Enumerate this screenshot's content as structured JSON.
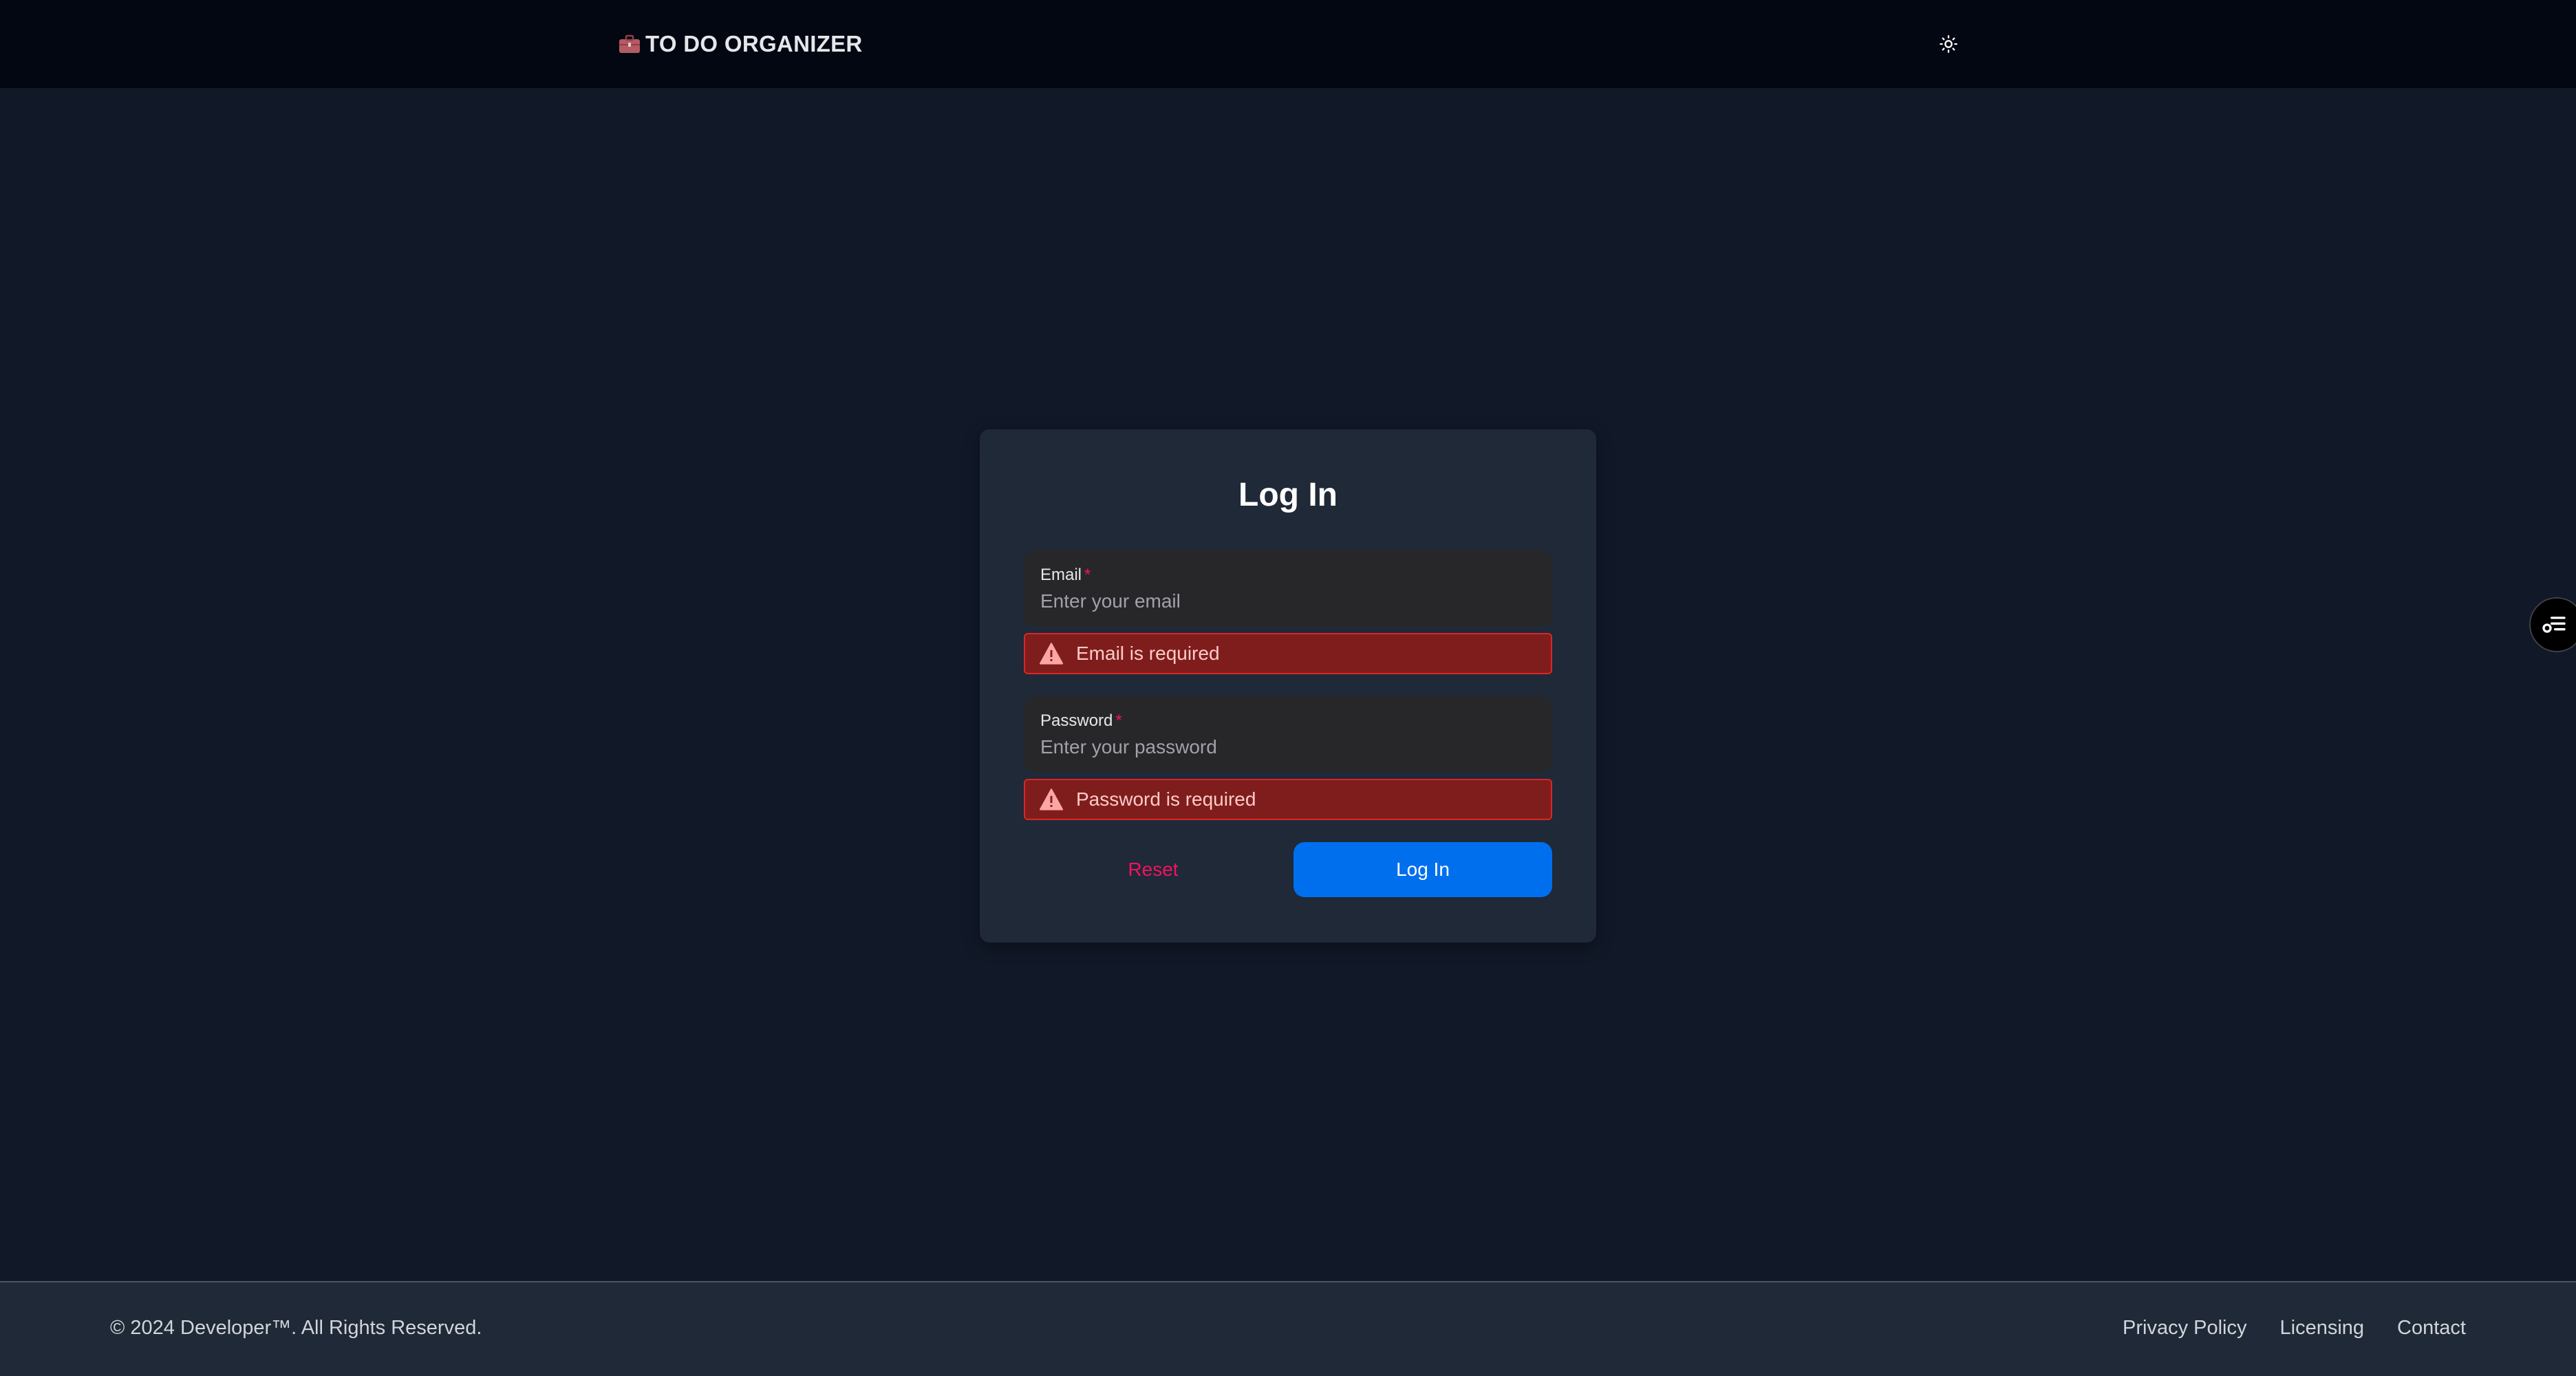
{
  "header": {
    "brand_title": "TO DO ORGANIZER",
    "brand_icon": "briefcase-icon",
    "theme_toggle_icon": "sun-icon"
  },
  "login_form": {
    "title": "Log In",
    "email": {
      "label": "Email",
      "required_marker": "*",
      "placeholder": "Enter your email",
      "value": "",
      "error": "Email is required"
    },
    "password": {
      "label": "Password",
      "required_marker": "*",
      "placeholder": "Enter your password",
      "value": "",
      "error": "Password is required"
    },
    "reset_label": "Reset",
    "submit_label": "Log In"
  },
  "side_button": {
    "icon": "settings-list-icon"
  },
  "footer": {
    "copyright": "© 2024 Developer™. All Rights Reserved.",
    "links": [
      "Privacy Policy",
      "Licensing",
      "Contact"
    ]
  },
  "colors": {
    "background": "#111827",
    "header": "#030712",
    "card": "#1f2937",
    "input": "#27272a",
    "error_bg": "#7f1d1d",
    "error_border": "#dc2626",
    "danger": "#f31260",
    "primary": "#006fee"
  }
}
